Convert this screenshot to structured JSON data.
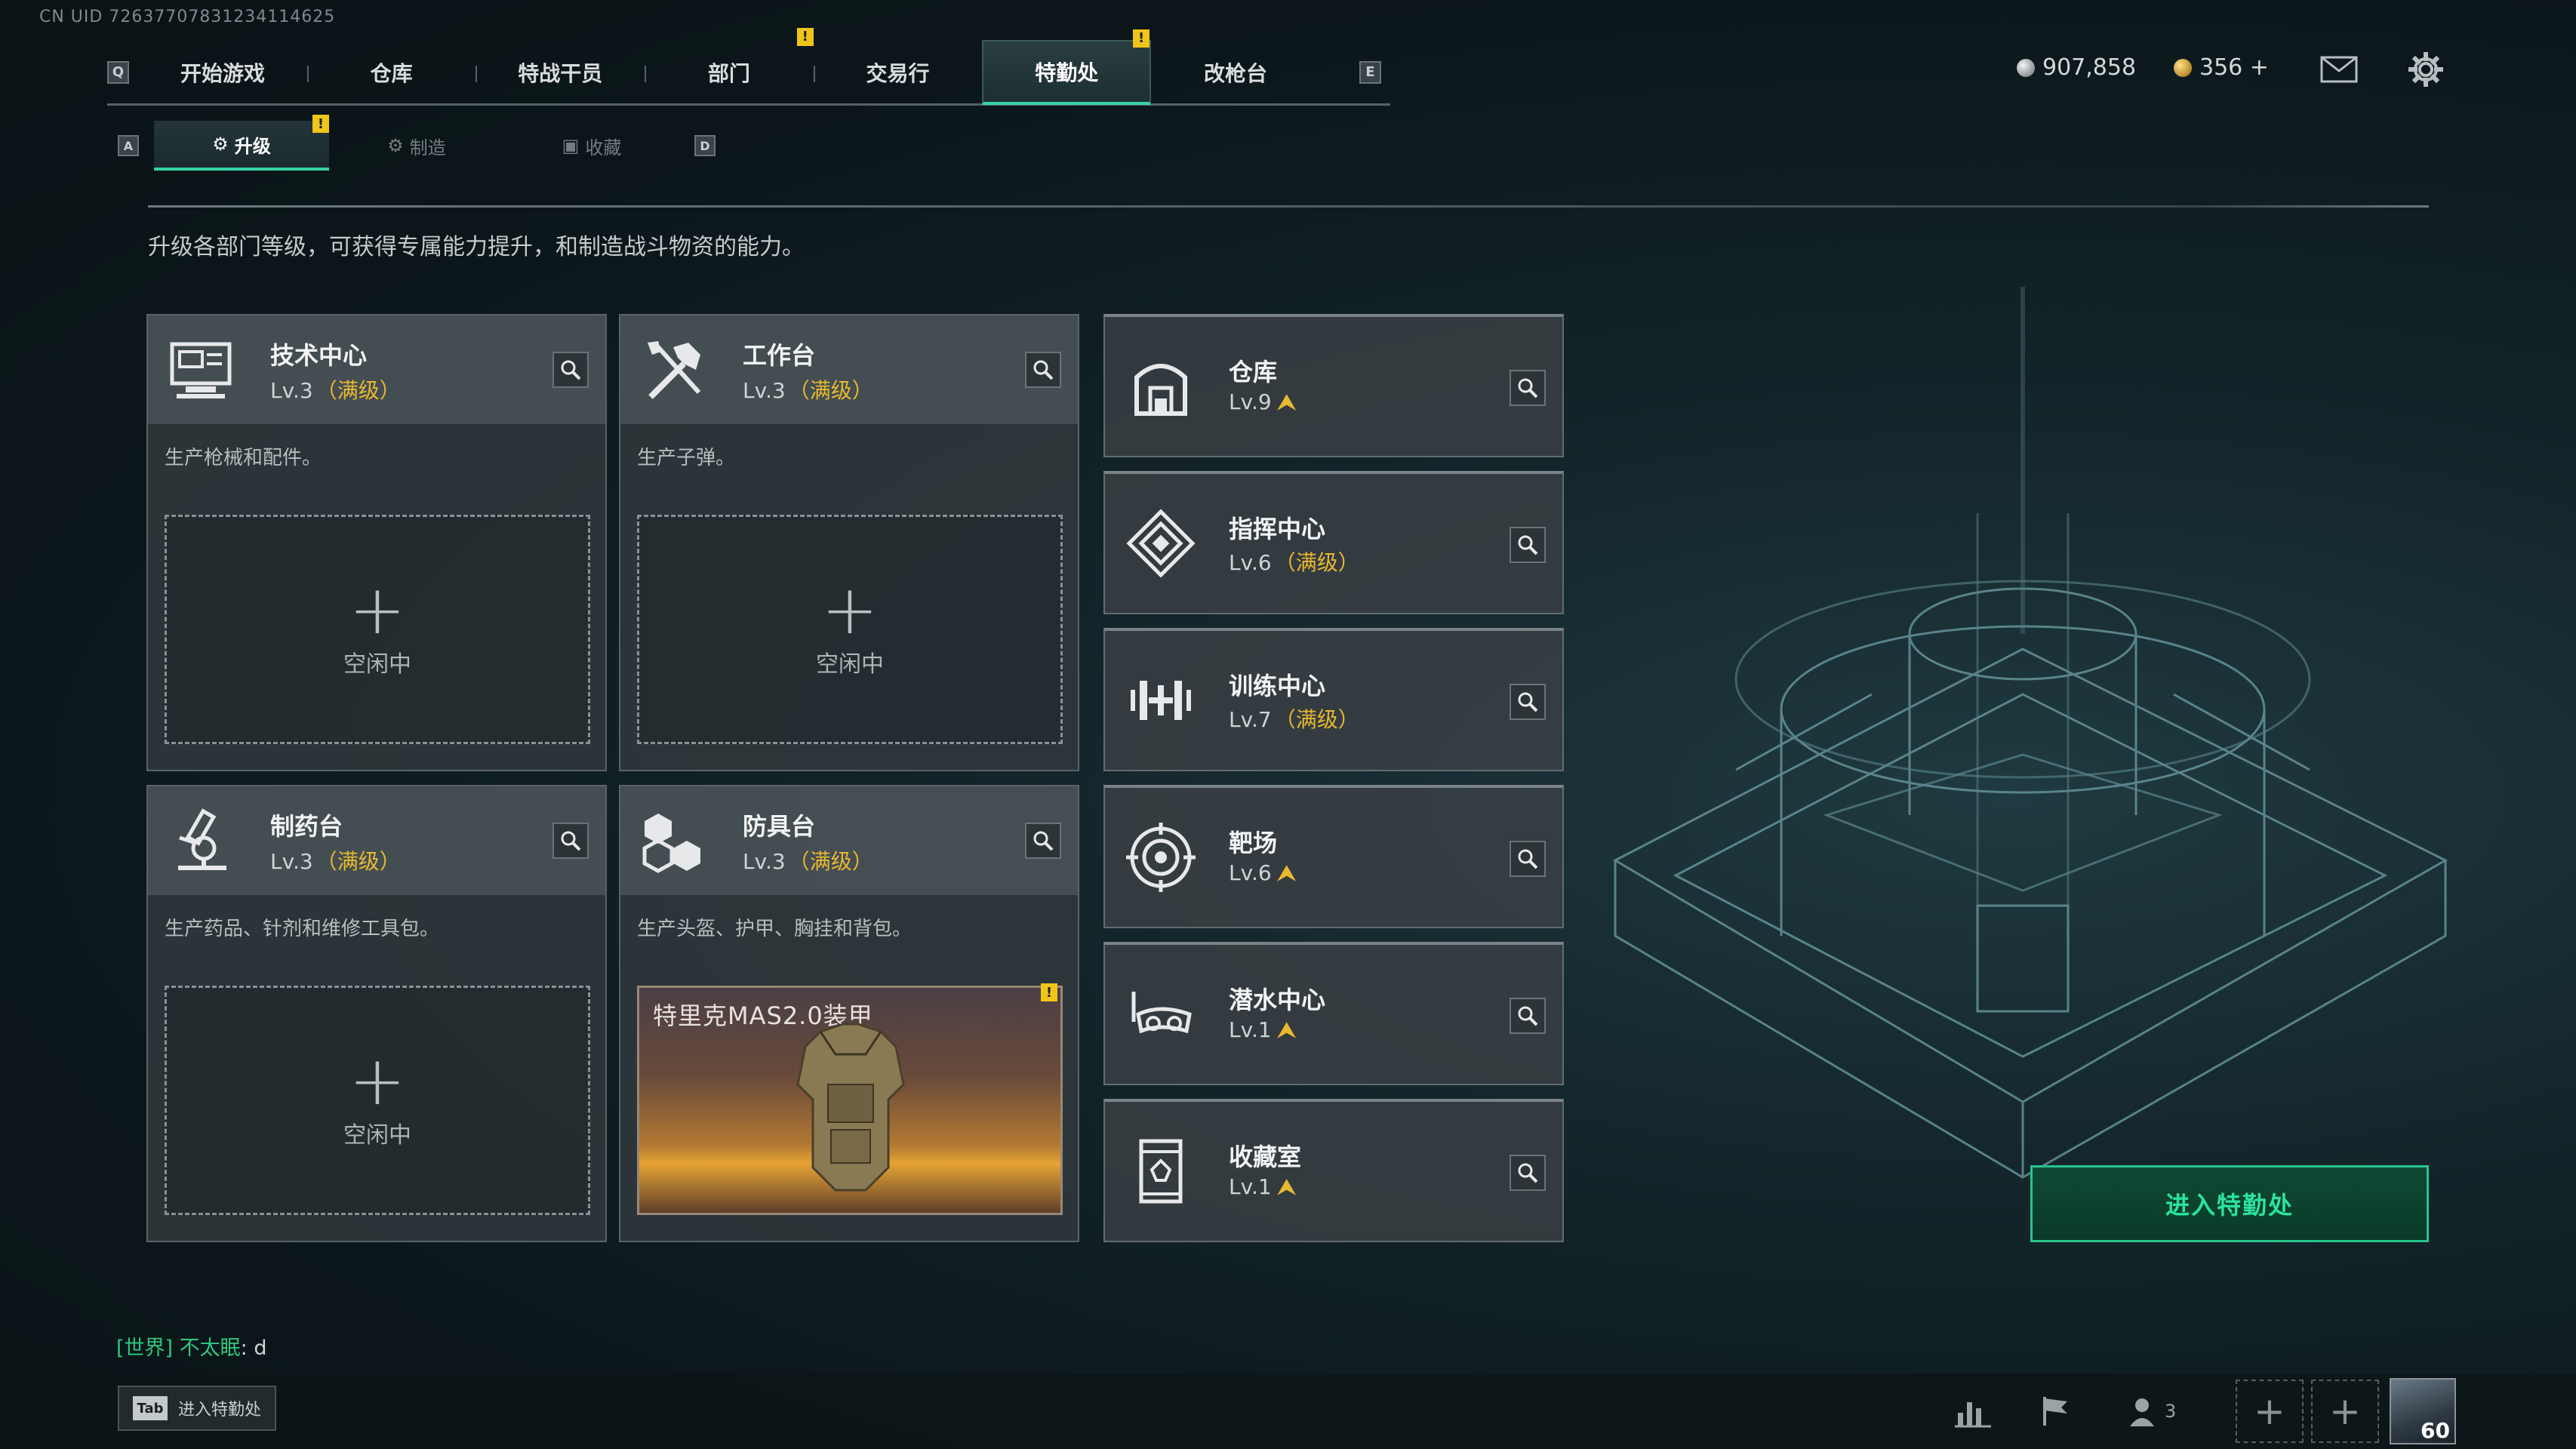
{
  "uid": "CN UID 7263770783123411462​5",
  "topnav": {
    "left_key": "Q",
    "right_key": "E",
    "tabs": [
      {
        "label": "开始游戏",
        "active": false,
        "alert": false
      },
      {
        "label": "仓库",
        "active": false,
        "alert": false
      },
      {
        "label": "特战干员",
        "active": false,
        "alert": false
      },
      {
        "label": "部门",
        "active": false,
        "alert": true
      },
      {
        "label": "交易行",
        "active": false,
        "alert": false
      },
      {
        "label": "特勤处",
        "active": true,
        "alert": true
      },
      {
        "label": "改枪台",
        "active": false,
        "alert": false
      }
    ]
  },
  "currency": {
    "coins": "907,858",
    "tickets": "356 +"
  },
  "subnav": {
    "left_key": "A",
    "right_key": "D",
    "tabs": [
      {
        "label": "升级",
        "active": true,
        "alert": true
      },
      {
        "label": "制造",
        "active": false,
        "alert": false
      },
      {
        "label": "收藏",
        "active": false,
        "alert": false
      }
    ]
  },
  "description": "升级各部门等级，可获得专属能力提升，和制造战斗物资的能力。",
  "production_depts": [
    {
      "name": "技术中心",
      "level": "Lv.3",
      "max": "（满级）",
      "desc": "生产枪械和配件。",
      "slot": {
        "status": "空闲中",
        "busy": false
      },
      "icon": "computer-icon"
    },
    {
      "name": "工作台",
      "level": "Lv.3",
      "max": "（满级）",
      "desc": "生产子弹。",
      "slot": {
        "status": "空闲中",
        "busy": false
      },
      "icon": "tools-icon"
    },
    {
      "name": "制药台",
      "level": "Lv.3",
      "max": "（满级）",
      "desc": "生产药品、针剂和维修工具包。",
      "slot": {
        "status": "空闲中",
        "busy": false
      },
      "icon": "microscope-icon"
    },
    {
      "name": "防具台",
      "level": "Lv.3",
      "max": "（满级）",
      "desc": "生产头盔、护甲、胸挂和背包。",
      "slot": {
        "status": "特里克MAS2.0装甲",
        "busy": true
      },
      "icon": "boxes-icon"
    }
  ],
  "other_depts": [
    {
      "name": "仓库",
      "level": "Lv.9",
      "max": "",
      "upgradable": true,
      "icon": "warehouse-icon"
    },
    {
      "name": "指挥中心",
      "level": "Lv.6",
      "max": "（满级）",
      "upgradable": false,
      "icon": "command-icon"
    },
    {
      "name": "训练中心",
      "level": "Lv.7",
      "max": "（满级）",
      "upgradable": false,
      "icon": "dumbbell-icon"
    },
    {
      "name": "靶场",
      "level": "Lv.6",
      "max": "",
      "upgradable": true,
      "icon": "target-icon"
    },
    {
      "name": "潜水中心",
      "level": "Lv.1",
      "max": "",
      "upgradable": true,
      "icon": "diving-mask-icon"
    },
    {
      "name": "收藏室",
      "level": "Lv.1",
      "max": "",
      "upgradable": true,
      "icon": "collection-icon"
    }
  ],
  "enter_button": "进入特勤处",
  "chat": {
    "channel": "[世界]",
    "name": "不太眠",
    "message": "d"
  },
  "tab_hint": {
    "key": "Tab",
    "label": "进入特勤处"
  },
  "bottom": {
    "squad_count": "3",
    "player_level": "60"
  },
  "colors": {
    "accent": "#35d3a2",
    "warning": "#f0c419",
    "max_level": "#e8b830",
    "chat_channel": "#2fc67e"
  }
}
